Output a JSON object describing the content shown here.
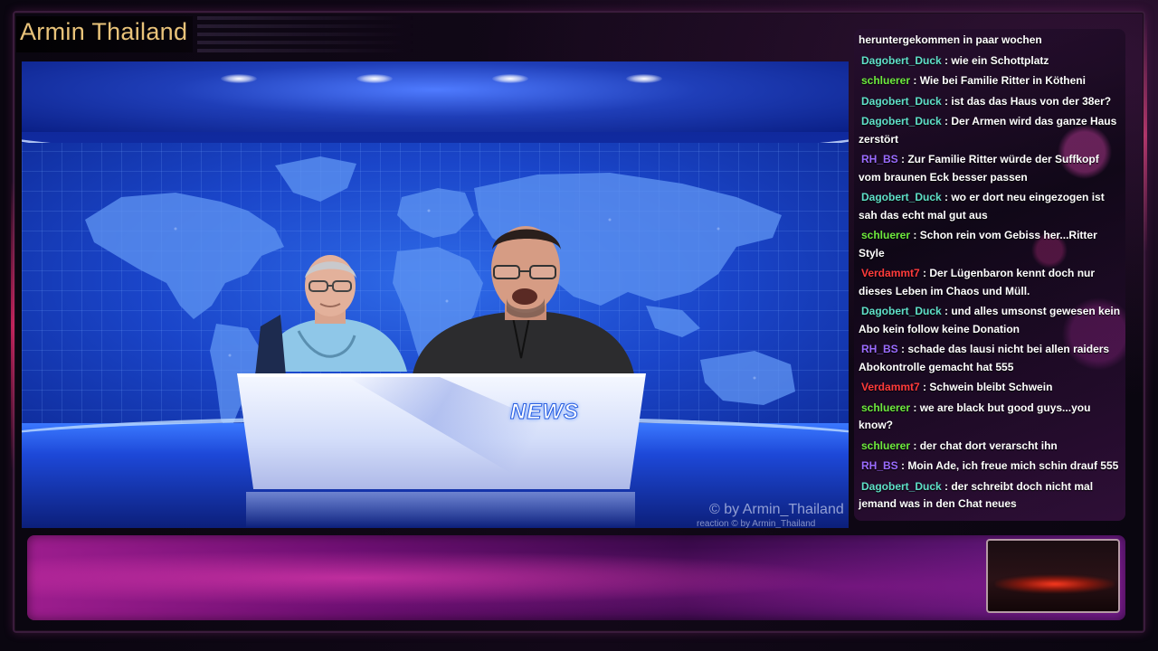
{
  "channel": {
    "title": "Armin Thailand"
  },
  "studio": {
    "news_label": "NEWS",
    "watermark": "© by Armin_Thailand",
    "sub_watermark": "reaction  © by Armin_Thailand"
  },
  "colors": {
    "title": "#e9c37a",
    "user_Dagobert_Duck": "#5fe0c8",
    "user_schluerer": "#6eea3e",
    "user_RH_BS": "#9b6bff",
    "user_Verdammt7": "#ff3b3b"
  },
  "chat": {
    "messages": [
      {
        "user": "",
        "text": "heruntergekommen in paar wochen",
        "color": ""
      },
      {
        "user": "Dagobert_Duck",
        "text": " : wie ein Schottplatz",
        "color": "#5fe0c8"
      },
      {
        "user": "schluerer",
        "text": " : Wie bei Familie Ritter in Kötheni",
        "color": "#6eea3e"
      },
      {
        "user": "Dagobert_Duck",
        "text": " : ist das das Haus von der 38er?",
        "color": "#5fe0c8"
      },
      {
        "user": "Dagobert_Duck",
        "text": " : Der Armen wird das ganze Haus zerstört",
        "color": "#5fe0c8"
      },
      {
        "user": "RH_BS",
        "text": " : Zur Familie Ritter würde der Suffkopf vom braunen Eck besser passen",
        "color": "#9b6bff"
      },
      {
        "user": "Dagobert_Duck",
        "text": " : wo er dort neu eingezogen ist sah das echt mal gut aus",
        "color": "#5fe0c8"
      },
      {
        "user": "schluerer",
        "text": " : Schon rein vom Gebiss her...Ritter Style",
        "color": "#6eea3e"
      },
      {
        "user": "Verdammt7",
        "text": " : Der Lügenbaron kennt doch nur dieses Leben im Chaos und Müll.",
        "color": "#ff3b3b"
      },
      {
        "user": "Dagobert_Duck",
        "text": " : und alles umsonst gewesen kein Abo kein follow keine Donation",
        "color": "#5fe0c8"
      },
      {
        "user": "RH_BS",
        "text": " : schade das lausi nicht bei allen raiders Abokontrolle gemacht hat 555",
        "color": "#9b6bff"
      },
      {
        "user": "Verdammt7",
        "text": " : Schwein bleibt Schwein",
        "color": "#ff3b3b"
      },
      {
        "user": "schluerer",
        "text": " : we are black but good guys...you know?",
        "color": "#6eea3e"
      },
      {
        "user": "schluerer",
        "text": " : der chat dort verarscht ihn",
        "color": "#6eea3e"
      },
      {
        "user": "RH_BS",
        "text": " : Moin Ade, ich freue mich schin drauf 555",
        "color": "#9b6bff"
      },
      {
        "user": "Dagobert_Duck",
        "text": " : der schreibt doch nicht mal jemand was in den Chat neues",
        "color": "#5fe0c8"
      }
    ]
  }
}
